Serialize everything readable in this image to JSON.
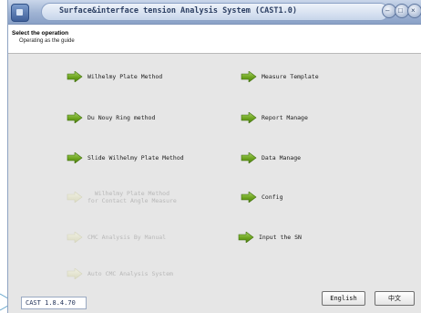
{
  "window": {
    "title": "Surface&interface tension Analysis System (CAST1.0)"
  },
  "header": {
    "title": "Select the operation",
    "subtitle": "Operating as the guide"
  },
  "menu": [
    {
      "key": "wilhelmy",
      "label": "Wilhelmy Plate Method",
      "enabled": true
    },
    {
      "key": "measure_template",
      "label": "Measure Template",
      "enabled": true
    },
    {
      "key": "du_nouy",
      "label": "Du Nouy Ring method",
      "enabled": true
    },
    {
      "key": "report_manage",
      "label": "Report Manage",
      "enabled": true
    },
    {
      "key": "slide_wilhelmy",
      "label": "Slide Wilhelmy Plate Method",
      "enabled": true
    },
    {
      "key": "data_manage",
      "label": "Data Manage",
      "enabled": true
    },
    {
      "key": "contact_angle",
      "label_line1": "Wilhelmy Plate Method",
      "label_line2": "for Contact Angle Measure",
      "enabled": false
    },
    {
      "key": "config",
      "label": "Config",
      "enabled": true
    },
    {
      "key": "cmc_manual",
      "label": "CMC Analysis By Manual",
      "enabled": false
    },
    {
      "key": "input_sn",
      "label": "Input the SN",
      "enabled": true
    },
    {
      "key": "auto_cmc",
      "label": "Auto CMC Analysis System",
      "enabled": false
    }
  ],
  "status": {
    "version": "CAST 1.8.4.70"
  },
  "language": {
    "english": "English",
    "chinese": "中文"
  },
  "colors": {
    "arrow_active": "#6ea51f",
    "arrow_disabled": "#e2e2c8",
    "titlebar": "#9fb3d3"
  }
}
